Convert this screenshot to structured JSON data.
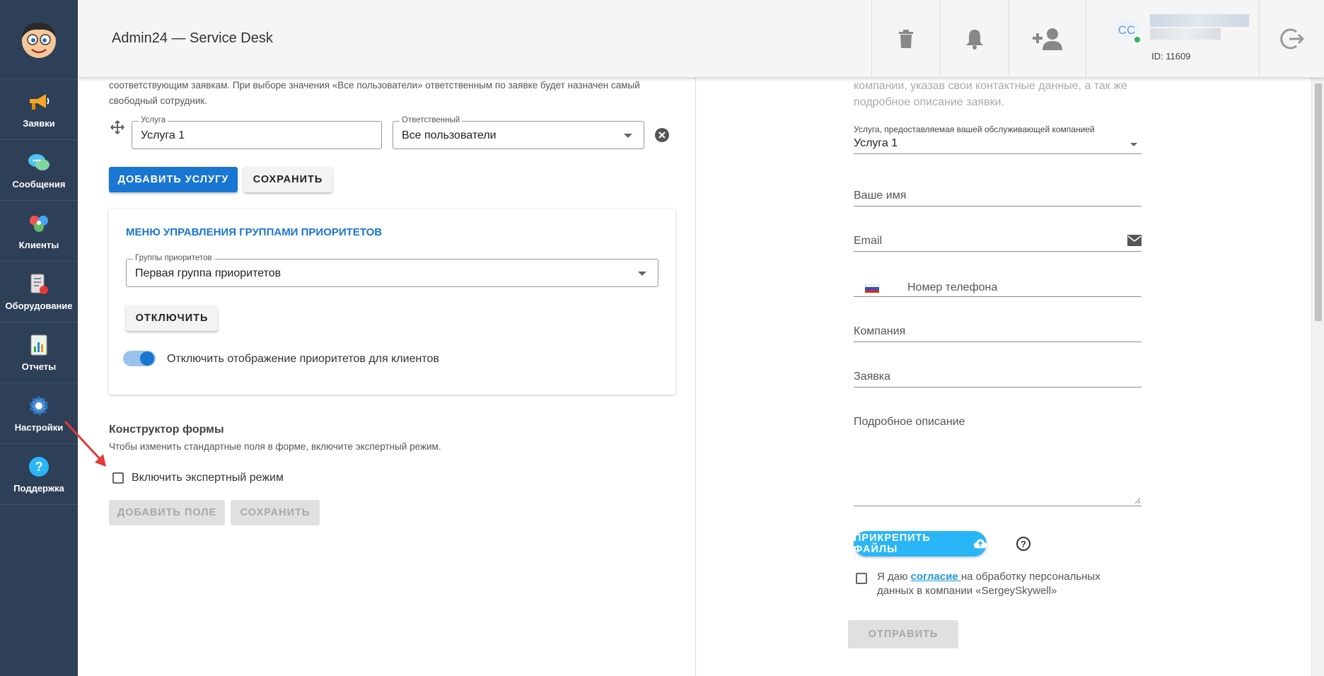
{
  "sidebar": {
    "items": [
      {
        "label": "Заявки",
        "icon": "megaphone-icon"
      },
      {
        "label": "Сообщения",
        "icon": "chat-icon"
      },
      {
        "label": "Клиенты",
        "icon": "clients-icon"
      },
      {
        "label": "Оборудование",
        "icon": "equipment-icon"
      },
      {
        "label": "Отчеты",
        "icon": "reports-icon"
      },
      {
        "label": "Настройки",
        "icon": "gear-icon"
      },
      {
        "label": "Поддержка",
        "icon": "help-icon"
      }
    ]
  },
  "header": {
    "title": "Admin24 — Service Desk",
    "user_initials": "CC",
    "user_id": "ID: 11609"
  },
  "left": {
    "description": "соответствующим заявкам. При выборе значения «Все пользователи» ответственным по заявке будет назначен самый свободный сотрудник.",
    "service_legend": "Услуга",
    "service_value": "Услуга 1",
    "responsible_legend": "Ответственный",
    "responsible_value": "Все пользователи",
    "add_service_label": "ДОБАВИТЬ УСЛУГУ",
    "save_label": "СОХРАНИТЬ",
    "priority_card": {
      "title": "МЕНЮ УПРАВЛЕНИЯ ГРУППАМИ ПРИОРИТЕТОВ",
      "groups_legend": "Группы приоритетов",
      "groups_value": "Первая группа приоритетов",
      "disable_label": "ОТКЛЮЧИТЬ",
      "toggle_label": "Отключить отображение приоритетов для клиентов",
      "toggle_on": true
    },
    "form_builder": {
      "title": "Конструктор формы",
      "subtitle": "Чтобы изменить стандартные поля в форме, включите экспертный режим.",
      "expert_label": "Включить экспертный режим",
      "add_field_label": "ДОБАВИТЬ ПОЛЕ",
      "save_label": "СОХРАНИТЬ"
    }
  },
  "right": {
    "intro": "компании, указав свои контактные данные, а так же подробное описание заявки.",
    "service_label": "Услуга, предоставляемая вашей обслуживающей компанией",
    "service_value": "Услуга 1",
    "name_label": "Ваше имя",
    "email_label": "Email",
    "phone_label": "Номер телефона",
    "company_label": "Компания",
    "request_label": "Заявка",
    "details_label": "Подробное описание",
    "attach_label": "ПРИКРЕПИТЬ ФАЙЛЫ",
    "help_symbol": "?",
    "consent_prefix": "Я даю ",
    "consent_link": "согласие ",
    "consent_suffix": "на обработку персональных данных в компании «SergeySkywell»",
    "submit_label": "ОТПРАВИТЬ"
  },
  "colors": {
    "sidebar": "#2e3f58",
    "primary": "#1976d2",
    "attach": "#29b6f6",
    "arrow": "#e53935"
  }
}
